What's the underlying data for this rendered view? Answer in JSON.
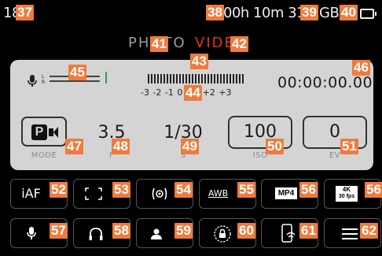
{
  "status_bar": {
    "time_partial": "18:",
    "recording_time": "00h 10m 31s",
    "storage_unit": "GB"
  },
  "mode_switch": {
    "photo_label": "PHOTO",
    "video_label": "VIDEO",
    "active": "video"
  },
  "audio": {
    "channel_left": "L",
    "channel_right": "R",
    "level_scale": "-3  -2  -1   0  +1  +2  +3"
  },
  "timecode": "00:00:00.00",
  "exposure": {
    "mode_label": "MODE",
    "aperture_value": "3.5",
    "aperture_label": "F",
    "shutter_value": "1/30",
    "shutter_label": "S",
    "iso_value": "100",
    "iso_label": "ISO",
    "ev_value": "0",
    "ev_label": "EV"
  },
  "buttons_row1": {
    "af_label": "iAF",
    "awb_label": "AWB",
    "format_label": "MP4",
    "resolution_label": "4K",
    "fps_label": "30 fps"
  },
  "callouts": [
    "37",
    "38",
    "39",
    "40",
    "41",
    "42",
    "43",
    "44",
    "45",
    "46",
    "47",
    "48",
    "49",
    "50",
    "51",
    "52",
    "53",
    "54",
    "55",
    "56",
    "56",
    "57",
    "58",
    "59",
    "60",
    "61",
    "62"
  ],
  "colors": {
    "callout": "#f07b3c",
    "video_active": "#e8301f",
    "panel_bg": "#d4d4d4",
    "peak_marker": "#28a745"
  }
}
